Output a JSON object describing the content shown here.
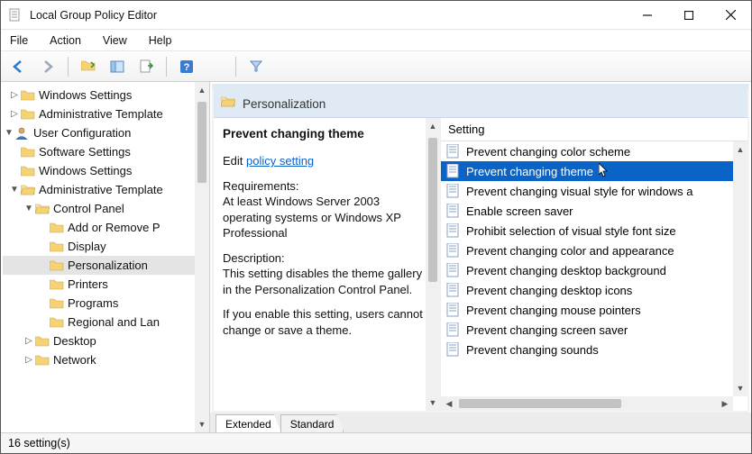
{
  "window": {
    "title": "Local Group Policy Editor"
  },
  "menu": {
    "file": "File",
    "action": "Action",
    "view": "View",
    "help": "Help"
  },
  "tree": [
    {
      "indent": 1,
      "caret": "▷",
      "icon": "folder",
      "label": "Windows Settings"
    },
    {
      "indent": 1,
      "caret": "▷",
      "icon": "folder",
      "label": "Administrative Template"
    },
    {
      "indent": 0,
      "caret": "▼",
      "icon": "user",
      "label": "User Configuration"
    },
    {
      "indent": 1,
      "caret": "",
      "icon": "folder",
      "label": "Software Settings"
    },
    {
      "indent": 1,
      "caret": "",
      "icon": "folder",
      "label": "Windows Settings"
    },
    {
      "indent": 1,
      "caret": "▼",
      "icon": "folder",
      "label": "Administrative Template"
    },
    {
      "indent": 2,
      "caret": "▼",
      "icon": "folder",
      "label": "Control Panel"
    },
    {
      "indent": 3,
      "caret": "",
      "icon": "folder",
      "label": "Add or Remove P"
    },
    {
      "indent": 3,
      "caret": "",
      "icon": "folder",
      "label": "Display"
    },
    {
      "indent": 3,
      "caret": "",
      "icon": "folder",
      "label": "Personalization",
      "selected": true
    },
    {
      "indent": 3,
      "caret": "",
      "icon": "folder",
      "label": "Printers"
    },
    {
      "indent": 3,
      "caret": "",
      "icon": "folder",
      "label": "Programs"
    },
    {
      "indent": 3,
      "caret": "",
      "icon": "folder",
      "label": "Regional and Lan"
    },
    {
      "indent": 2,
      "caret": "▷",
      "icon": "folder",
      "label": "Desktop"
    },
    {
      "indent": 2,
      "caret": "▷",
      "icon": "folder",
      "label": "Network"
    }
  ],
  "header": {
    "title": "Personalization"
  },
  "description": {
    "setting_title": "Prevent changing theme",
    "edit_prefix": "Edit ",
    "edit_link": "policy setting",
    "requirements_label": "Requirements:",
    "requirements_text": "At least Windows Server 2003 operating systems or Windows XP Professional",
    "description_label": "Description:",
    "description_text": "This setting disables the theme gallery in the Personalization Control Panel.",
    "footer_text": "If you enable this setting, users cannot change or save a theme."
  },
  "list": {
    "header": "Setting",
    "items": [
      "Prevent changing color scheme",
      "Prevent changing theme",
      "Prevent changing visual style for windows a",
      "Enable screen saver",
      "Prohibit selection of visual style font size",
      "Prevent changing color and appearance",
      "Prevent changing desktop background",
      "Prevent changing desktop icons",
      "Prevent changing mouse pointers",
      "Prevent changing screen saver",
      "Prevent changing sounds"
    ],
    "selected_index": 1
  },
  "tabs": {
    "extended": "Extended",
    "standard": "Standard"
  },
  "status": "16 setting(s)"
}
